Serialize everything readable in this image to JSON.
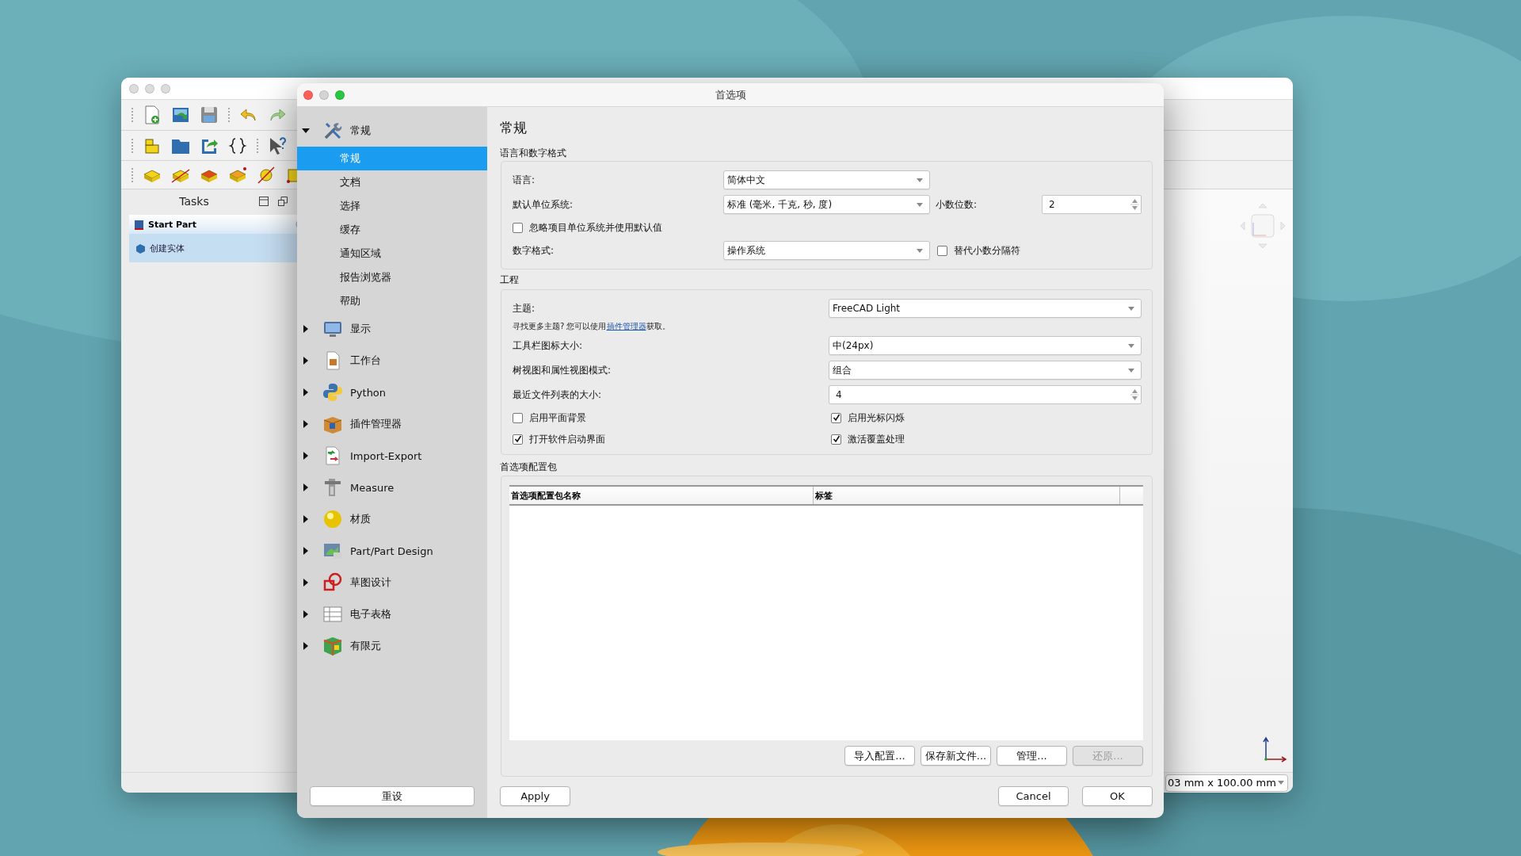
{
  "background_window": {
    "tasks_panel": {
      "title": "Tasks",
      "section": "Start Part",
      "items": [
        "创建实体"
      ]
    },
    "status_field": "03 mm x 100.00 mm"
  },
  "dialog": {
    "title": "首选项",
    "sidebar": {
      "groups": [
        {
          "label": "常规",
          "expanded": true,
          "children": [
            {
              "label": "常规",
              "selected": true
            },
            {
              "label": "文档",
              "selected": false
            },
            {
              "label": "选择",
              "selected": false
            },
            {
              "label": "缓存",
              "selected": false
            },
            {
              "label": "通知区域",
              "selected": false
            },
            {
              "label": "报告浏览器",
              "selected": false
            },
            {
              "label": "帮助",
              "selected": false
            }
          ]
        },
        {
          "label": "显示",
          "expanded": false
        },
        {
          "label": "工作台",
          "expanded": false
        },
        {
          "label": "Python",
          "expanded": false
        },
        {
          "label": "插件管理器",
          "expanded": false
        },
        {
          "label": "Import-Export",
          "expanded": false
        },
        {
          "label": "Measure",
          "expanded": false
        },
        {
          "label": "材质",
          "expanded": false
        },
        {
          "label": "Part/Part Design",
          "expanded": false
        },
        {
          "label": "草图设计",
          "expanded": false
        },
        {
          "label": "电子表格",
          "expanded": false
        },
        {
          "label": "有限元",
          "expanded": false
        }
      ],
      "reset_button": "重设"
    },
    "page": {
      "title": "常规",
      "language_section": {
        "title": "语言和数字格式",
        "language": {
          "label": "语言:",
          "value": "简体中文"
        },
        "unit_system": {
          "label": "默认单位系统:",
          "value": "标准 (毫米, 千克, 秒, 度)"
        },
        "decimals": {
          "label": "小数位数:",
          "value": "2"
        },
        "ignore_project_units": {
          "label": "忽略项目单位系统并使用默认值",
          "checked": false
        },
        "number_format": {
          "label": "数字格式:",
          "value": "操作系统"
        },
        "substitute_separator": {
          "label": "替代小数分隔符",
          "checked": false
        }
      },
      "project_section": {
        "title": "工程",
        "theme": {
          "label": "主题:",
          "value": "FreeCAD Light"
        },
        "theme_hint": {
          "before": "寻找更多主题? 您可以使用",
          "link": "插件管理器",
          "after": "获取。"
        },
        "toolbar_icon_size": {
          "label": "工具栏图标大小:",
          "value": "中(24px)"
        },
        "tree_mode": {
          "label": "树视图和属性视图模式:",
          "value": "组合"
        },
        "recent_files": {
          "label": "最近文件列表的大小:",
          "value": "4"
        },
        "checkboxes": [
          {
            "label": "启用平面背景",
            "checked": false
          },
          {
            "label": "启用光标闪烁",
            "checked": true
          },
          {
            "label": "打开软件启动界面",
            "checked": true
          },
          {
            "label": "激活覆盖处理",
            "checked": true
          }
        ]
      },
      "packs_section": {
        "title": "首选项配置包",
        "table": {
          "columns": [
            "首选项配置包名称",
            "标签"
          ]
        },
        "buttons": [
          {
            "label": "导入配置...",
            "disabled": false
          },
          {
            "label": "保存新文件...",
            "disabled": false
          },
          {
            "label": "管理...",
            "disabled": false
          },
          {
            "label": "还原...",
            "disabled": true
          }
        ]
      }
    },
    "buttons": {
      "apply": "Apply",
      "cancel": "Cancel",
      "ok": "OK"
    }
  }
}
